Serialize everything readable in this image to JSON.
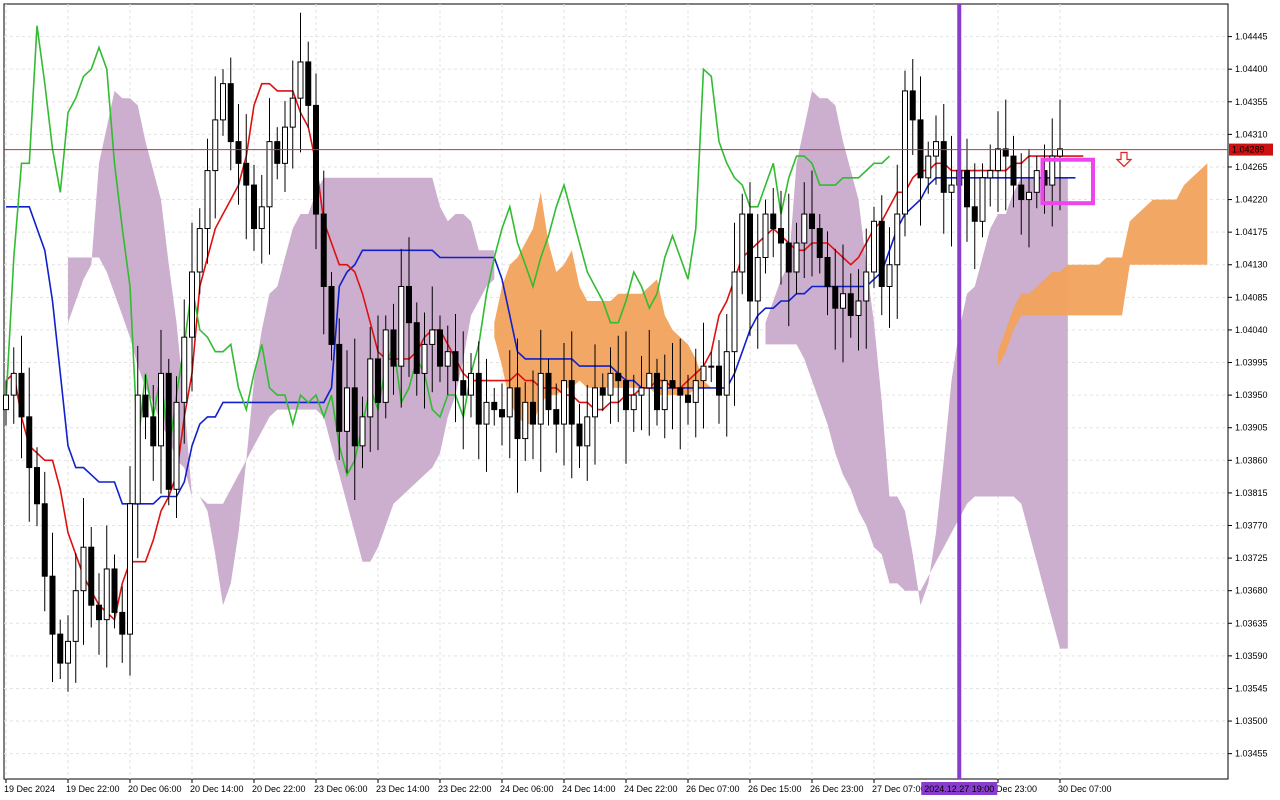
{
  "chart_data": {
    "type": "candlestick",
    "title": "",
    "xlabel": "",
    "ylabel": "",
    "ylim": [
      1.0342,
      1.0449
    ],
    "grid": true,
    "y_ticks": [
      "1.04445",
      "1.04400",
      "1.04355",
      "1.04310",
      "1.04265",
      "1.04220",
      "1.04175",
      "1.04130",
      "1.04085",
      "1.04040",
      "1.03995",
      "1.03950",
      "1.03905",
      "1.03860",
      "1.03815",
      "1.03770",
      "1.03725",
      "1.03680",
      "1.03635",
      "1.03590",
      "1.03545",
      "1.03500",
      "1.03455"
    ],
    "x_ticks": [
      {
        "i": 0,
        "label": "19 Dec 2024"
      },
      {
        "i": 8,
        "label": "19 Dec 22:00"
      },
      {
        "i": 16,
        "label": "20 Dec 06:00"
      },
      {
        "i": 24,
        "label": "20 Dec 14:00"
      },
      {
        "i": 32,
        "label": "20 Dec 22:00"
      },
      {
        "i": 40,
        "label": "23 Dec 06:00"
      },
      {
        "i": 48,
        "label": "23 Dec 14:00"
      },
      {
        "i": 56,
        "label": "23 Dec 22:00"
      },
      {
        "i": 64,
        "label": "24 Dec 06:00"
      },
      {
        "i": 72,
        "label": "24 Dec 14:00"
      },
      {
        "i": 80,
        "label": "24 Dec 22:00"
      },
      {
        "i": 88,
        "label": "26 Dec 07:00"
      },
      {
        "i": 96,
        "label": "26 Dec 15:00"
      },
      {
        "i": 104,
        "label": "26 Dec 23:00"
      },
      {
        "i": 112,
        "label": "27 Dec 07:00"
      },
      {
        "i": 128,
        "label": "Dec 23:00"
      },
      {
        "i": 136,
        "label": "30 Dec 07:00"
      }
    ],
    "current_price": "1.04289",
    "current_price_value": 1.04289,
    "marker_label": "2024.12.27 19:00",
    "marker_index": 123,
    "close_series": [
      1.0395,
      1.0398,
      1.0392,
      1.0385,
      1.038,
      1.037,
      1.0362,
      1.0358,
      1.0361,
      1.0368,
      1.0374,
      1.0366,
      1.0364,
      1.0371,
      1.0365,
      1.0362,
      1.038,
      1.0395,
      1.0392,
      1.0388,
      1.0398,
      1.0382,
      1.0394,
      1.0403,
      1.0412,
      1.0418,
      1.0426,
      1.0433,
      1.0438,
      1.043,
      1.0427,
      1.0424,
      1.0418,
      1.0421,
      1.043,
      1.0427,
      1.0432,
      1.0436,
      1.0441,
      1.0435,
      1.042,
      1.041,
      1.0402,
      1.039,
      1.0396,
      1.0388,
      1.0392,
      1.04,
      1.0394,
      1.0404,
      1.0399,
      1.041,
      1.0405,
      1.0398,
      1.0402,
      1.0404,
      1.0399,
      1.0401,
      1.0397,
      1.0395,
      1.0398,
      1.0391,
      1.0394,
      1.0393,
      1.0392,
      1.0396,
      1.0389,
      1.0394,
      1.0391,
      1.0398,
      1.0393,
      1.0391,
      1.0397,
      1.0391,
      1.0388,
      1.0392,
      1.0396,
      1.0395,
      1.0398,
      1.0397,
      1.0393,
      1.0395,
      1.0396,
      1.0398,
      1.0393,
      1.0397,
      1.0396,
      1.0395,
      1.0394,
      1.0397,
      1.0399,
      1.0399,
      1.0395,
      1.0401,
      1.0412,
      1.042,
      1.0408,
      1.0414,
      1.042,
      1.0418,
      1.0416,
      1.0412,
      1.0416,
      1.042,
      1.0418,
      1.0414,
      1.041,
      1.0407,
      1.0409,
      1.0406,
      1.0408,
      1.0412,
      1.0419,
      1.041,
      1.0413,
      1.042,
      1.0437,
      1.0433,
      1.0425,
      1.0428,
      1.043,
      1.0423,
      1.0424,
      1.0426,
      1.0421,
      1.0419,
      1.0425,
      1.0426,
      1.0429,
      1.0428,
      1.0424,
      1.0422,
      1.0423,
      1.0426,
      1.0424,
      1.0428,
      1.0429
    ],
    "tenkan_series": [
      1.0397,
      1.0398,
      1.0392,
      1.0388,
      1.0387,
      1.0386,
      1.0386,
      1.0382,
      1.0376,
      1.0373,
      1.037,
      1.0368,
      1.0366,
      1.0365,
      1.0364,
      1.0369,
      1.0372,
      1.0372,
      1.0372,
      1.0375,
      1.0379,
      1.0381,
      1.0384,
      1.0392,
      1.0398,
      1.041,
      1.0414,
      1.0418,
      1.042,
      1.0422,
      1.0424,
      1.0428,
      1.0435,
      1.0438,
      1.0438,
      1.0437,
      1.0437,
      1.0437,
      1.0434,
      1.0432,
      1.0427,
      1.0419,
      1.0416,
      1.0413,
      1.0413,
      1.0412,
      1.0409,
      1.0405,
      1.0401,
      1.04,
      1.04,
      1.04,
      1.04,
      1.0401,
      1.0403,
      1.0404,
      1.0404,
      1.0402,
      1.04,
      1.0398,
      1.0397,
      1.0397,
      1.0397,
      1.0397,
      1.0397,
      1.0397,
      1.0398,
      1.0397,
      1.0397,
      1.0396,
      1.0396,
      1.0396,
      1.0395,
      1.0395,
      1.0394,
      1.0394,
      1.0393,
      1.0393,
      1.0394,
      1.0394,
      1.0395,
      1.0395,
      1.0396,
      1.0396,
      1.0397,
      1.0397,
      1.0396,
      1.0396,
      1.0397,
      1.0398,
      1.0399,
      1.0401,
      1.0406,
      1.0408,
      1.0411,
      1.0414,
      1.0415,
      1.0416,
      1.0417,
      1.0418,
      1.0417,
      1.0416,
      1.0415,
      1.0415,
      1.0416,
      1.0416,
      1.0416,
      1.0415,
      1.0414,
      1.0413,
      1.0414,
      1.0416,
      1.0418,
      1.0419,
      1.0421,
      1.0423,
      1.0423,
      1.0425,
      1.0426,
      1.0426,
      1.0427,
      1.0427,
      1.0426,
      1.0426,
      1.0426,
      1.0426,
      1.0426,
      1.0426,
      1.0426,
      1.0426,
      1.0427,
      1.0427,
      1.0428,
      1.0428,
      1.0428,
      1.0428,
      1.0428,
      1.0428,
      1.0428,
      1.0428
    ],
    "kijun_series": [
      1.0421,
      1.0421,
      1.0421,
      1.0421,
      1.0418,
      1.0415,
      1.0408,
      1.0398,
      1.0388,
      1.0385,
      1.0385,
      1.0384,
      1.0383,
      1.0383,
      1.0383,
      1.038,
      1.038,
      1.038,
      1.038,
      1.038,
      1.0381,
      1.0381,
      1.0381,
      1.0383,
      1.0388,
      1.0391,
      1.0392,
      1.0392,
      1.0394,
      1.0394,
      1.0394,
      1.0394,
      1.0394,
      1.0394,
      1.0394,
      1.0394,
      1.0394,
      1.0394,
      1.0394,
      1.0394,
      1.0394,
      1.0394,
      1.0396,
      1.041,
      1.0412,
      1.0413,
      1.0415,
      1.0415,
      1.0415,
      1.0415,
      1.0415,
      1.0415,
      1.0415,
      1.0415,
      1.0415,
      1.0415,
      1.0414,
      1.0414,
      1.0414,
      1.0414,
      1.0414,
      1.0414,
      1.0414,
      1.0414,
      1.0411,
      1.0406,
      1.0401,
      1.04,
      1.04,
      1.04,
      1.04,
      1.04,
      1.04,
      1.04,
      1.0399,
      1.0399,
      1.0399,
      1.0399,
      1.0399,
      1.0398,
      1.0397,
      1.0397,
      1.0396,
      1.0396,
      1.0396,
      1.0396,
      1.0396,
      1.0396,
      1.0396,
      1.0396,
      1.0396,
      1.0396,
      1.0396,
      1.0396,
      1.0398,
      1.0401,
      1.0404,
      1.0406,
      1.0407,
      1.0407,
      1.0408,
      1.0408,
      1.0409,
      1.0409,
      1.041,
      1.041,
      1.041,
      1.041,
      1.041,
      1.041,
      1.041,
      1.041,
      1.0411,
      1.0412,
      1.0415,
      1.0418,
      1.042,
      1.0421,
      1.0422,
      1.0424,
      1.0425,
      1.0425,
      1.0425,
      1.0425,
      1.0425,
      1.0425,
      1.0425,
      1.0425,
      1.0425,
      1.0425,
      1.0425,
      1.0425,
      1.0425,
      1.0425,
      1.0425,
      1.0425,
      1.0425,
      1.0425,
      1.0425
    ],
    "chikou_series": [
      1.0394,
      1.0414,
      1.0427,
      1.0427,
      1.0446,
      1.0438,
      1.0429,
      1.0423,
      1.0434,
      1.0436,
      1.0439,
      1.044,
      1.0443,
      1.044,
      1.0427,
      1.0418,
      1.041,
      1.0388,
      1.0398,
      1.0392,
      1.0398,
      1.0387,
      1.0395,
      1.0402,
      1.041,
      1.0404,
      1.0403,
      1.0401,
      1.0401,
      1.0402,
      1.0396,
      1.0393,
      1.0398,
      1.0402,
      1.0396,
      1.0395,
      1.0395,
      1.0391,
      1.0395,
      1.0394,
      1.0395,
      1.0392,
      1.0395,
      1.0388,
      1.0384,
      1.0386,
      1.0391,
      1.0396,
      1.0393,
      1.0399,
      1.0402,
      1.0394,
      1.0396,
      1.04,
      1.0398,
      1.0393,
      1.0392,
      1.0395,
      1.0395,
      1.0392,
      1.0398,
      1.0402,
      1.0409,
      1.0414,
      1.0418,
      1.0421,
      1.0416,
      1.0413,
      1.041,
      1.0414,
      1.0417,
      1.0421,
      1.0424,
      1.042,
      1.0416,
      1.0412,
      1.041,
      1.0408,
      1.0405,
      1.0405,
      1.0408,
      1.0412,
      1.041,
      1.0407,
      1.0409,
      1.0414,
      1.0417,
      1.0414,
      1.0411,
      1.0418,
      1.044,
      1.0439,
      1.043,
      1.0427,
      1.0425,
      1.0424,
      1.0421,
      1.0421,
      1.0424,
      1.0427,
      1.042,
      1.0425,
      1.0428,
      1.0428,
      1.0427,
      1.0424,
      1.0424,
      1.0424,
      1.0425,
      1.0425,
      1.0425,
      1.0426,
      1.0427,
      1.0427,
      1.0428
    ],
    "cloud_purple_upper": [
      1.0405,
      1.0408,
      1.0411,
      1.0413,
      1.0427,
      1.0432,
      1.0437,
      1.0436,
      1.0436,
      1.0435,
      1.043,
      1.0426,
      1.0422,
      1.0413,
      1.0405,
      1.0394,
      1.0381,
      1.0381,
      1.0379,
      1.0373,
      1.0366,
      1.0369,
      1.0376,
      1.0386,
      1.0397,
      1.0404,
      1.0409,
      1.041,
      1.0414,
      1.0418,
      1.042,
      1.042,
      1.0423,
      1.0425,
      1.0425,
      1.0425,
      1.0425,
      1.0425,
      1.0425,
      1.0425,
      1.0425,
      1.0425,
      1.0425,
      1.0425,
      1.0425,
      1.0425,
      1.0425,
      1.0425,
      1.0421,
      1.0419,
      1.042,
      1.042,
      1.0419,
      1.0415,
      1.0415,
      1.0415
    ],
    "cloud_purple_lower": [
      1.0414,
      1.0414,
      1.0414,
      1.0414,
      1.0414,
      1.0412,
      1.0409,
      1.0406,
      1.0403,
      1.0399,
      1.0396,
      1.0394,
      1.0391,
      1.0389,
      1.0386,
      1.0385,
      1.0381,
      1.0381,
      1.038,
      1.038,
      1.038,
      1.0382,
      1.0384,
      1.0386,
      1.0388,
      1.039,
      1.0392,
      1.0393,
      1.0393,
      1.0393,
      1.0393,
      1.0393,
      1.0393,
      1.0392,
      1.0388,
      1.0384,
      1.038,
      1.0376,
      1.0372,
      1.0372,
      1.0374,
      1.0377,
      1.038,
      1.0381,
      1.0382,
      1.0383,
      1.0384,
      1.0385,
      1.0387,
      1.0392,
      1.0395,
      1.04,
      1.0406,
      1.0408,
      1.041,
      1.0411
    ],
    "cloud_orange_upper": [
      1.0405,
      1.041,
      1.0413,
      1.0414,
      1.0416,
      1.0418,
      1.0423,
      1.0416,
      1.0412,
      1.0413,
      1.0415,
      1.041,
      1.0408,
      1.0408,
      1.0408,
      1.0408,
      1.0409,
      1.0409,
      1.0409,
      1.0409,
      1.041,
      1.0411,
      1.0406,
      1.0404,
      1.0403,
      1.0402,
      1.04,
      1.0397,
      1.0396,
      1.0396
    ],
    "cloud_orange_lower": [
      1.0403,
      1.0399,
      1.0394,
      1.0392,
      1.0391,
      1.0391,
      1.0394,
      1.0395,
      1.0395,
      1.0396,
      1.0396,
      1.0397,
      1.0396,
      1.0396,
      1.0396,
      1.0396,
      1.0396,
      1.0396,
      1.0396,
      1.0396,
      1.0396,
      1.0395,
      1.0395,
      1.0395,
      1.0395,
      1.0395,
      1.0396,
      1.0396,
      1.0396,
      1.0396
    ],
    "future_cloud_orange_upper": [
      1.0401,
      1.0404,
      1.0407,
      1.0409,
      1.0409,
      1.041,
      1.0411,
      1.0412,
      1.0412,
      1.0413,
      1.0413,
      1.0413,
      1.0413,
      1.0413,
      1.0414,
      1.0414,
      1.0414,
      1.0419,
      1.042,
      1.0421,
      1.0422,
      1.0422,
      1.0422,
      1.0422,
      1.0424,
      1.0425,
      1.0426,
      1.0427
    ],
    "future_cloud_orange_lower": [
      1.0399,
      1.0401,
      1.0404,
      1.0406,
      1.0406,
      1.0406,
      1.0406,
      1.0406,
      1.0406,
      1.0406,
      1.0406,
      1.0406,
      1.0406,
      1.0406,
      1.0406,
      1.0406,
      1.0406,
      1.0413,
      1.0413,
      1.0413,
      1.0413,
      1.0413,
      1.0413,
      1.0413,
      1.0413,
      1.0413,
      1.0413,
      1.0413
    ],
    "colors": {
      "tenkan": "#dd1111",
      "kijun": "#1020cc",
      "chikou": "#33bb33",
      "cloud_purple": "#c9aacb",
      "cloud_orange": "#f2a25c",
      "marker": "#8a3ccf",
      "highlight_box": "#ee44ee",
      "price_line": "#cc3333",
      "price_tag": "#cc1111",
      "arrow": "#dd2222"
    }
  }
}
